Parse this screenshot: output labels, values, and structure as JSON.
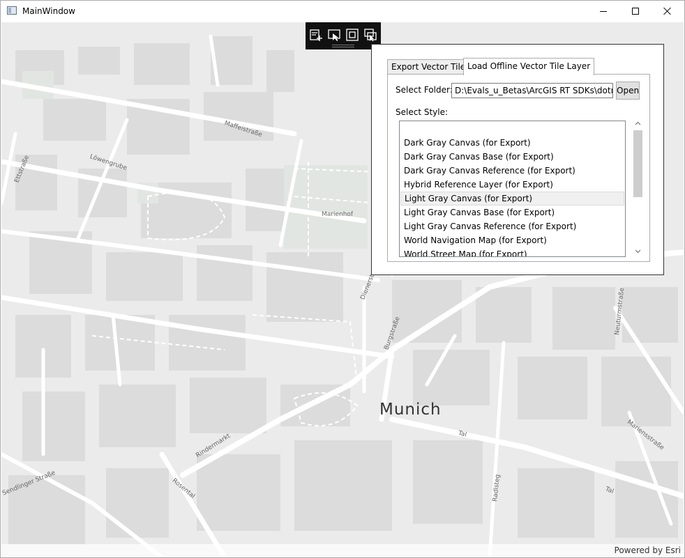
{
  "window": {
    "title": "MainWindow"
  },
  "map": {
    "city": "Munich",
    "attribution": "Powered by Esri",
    "streets": [
      {
        "name": "Maffeistraße"
      },
      {
        "name": "Löwengrube"
      },
      {
        "name": "Ettstraße"
      },
      {
        "name": "Dienerstraße"
      },
      {
        "name": "Burgstraße"
      },
      {
        "name": "Rindermarkt"
      },
      {
        "name": "Rosental"
      },
      {
        "name": "Radlsteg"
      },
      {
        "name": "Tal"
      },
      {
        "name": "Tal"
      },
      {
        "name": "Mariensstraße"
      },
      {
        "name": "Neuturmstraße"
      },
      {
        "name": "Sendlinger Straße"
      }
    ],
    "park": "Marienhof"
  },
  "toolbar": {
    "tools": [
      {
        "icon": "add-layer-icon"
      },
      {
        "icon": "select-icon"
      },
      {
        "icon": "extent-icon"
      },
      {
        "icon": "measure-icon"
      }
    ]
  },
  "panel": {
    "tabs": [
      {
        "label": "Export Vector Tiles"
      },
      {
        "label": "Load Offline Vector Tile Layer"
      }
    ],
    "folder_label": "Select Folder:",
    "folder_value": "D:\\Evals_u_Betas\\ArcGIS RT SDKs\\dotnet\\Q",
    "open_label": "Open",
    "style_label": "Select Style:",
    "styles": [
      "",
      "Dark Gray Canvas (for Export)",
      "Dark Gray Canvas Base (for Export)",
      "Dark Gray Canvas Reference (for Export)",
      "Hybrid Reference Layer (for Export)",
      "Light Gray Canvas (for Export)",
      "Light Gray Canvas Base (for Export)",
      "Light Gray Canvas Reference (for Export)",
      "World Navigation Map (for Export)",
      "World Street Map (for Export)"
    ],
    "selected_style": "Light Gray Canvas (for Export)"
  }
}
